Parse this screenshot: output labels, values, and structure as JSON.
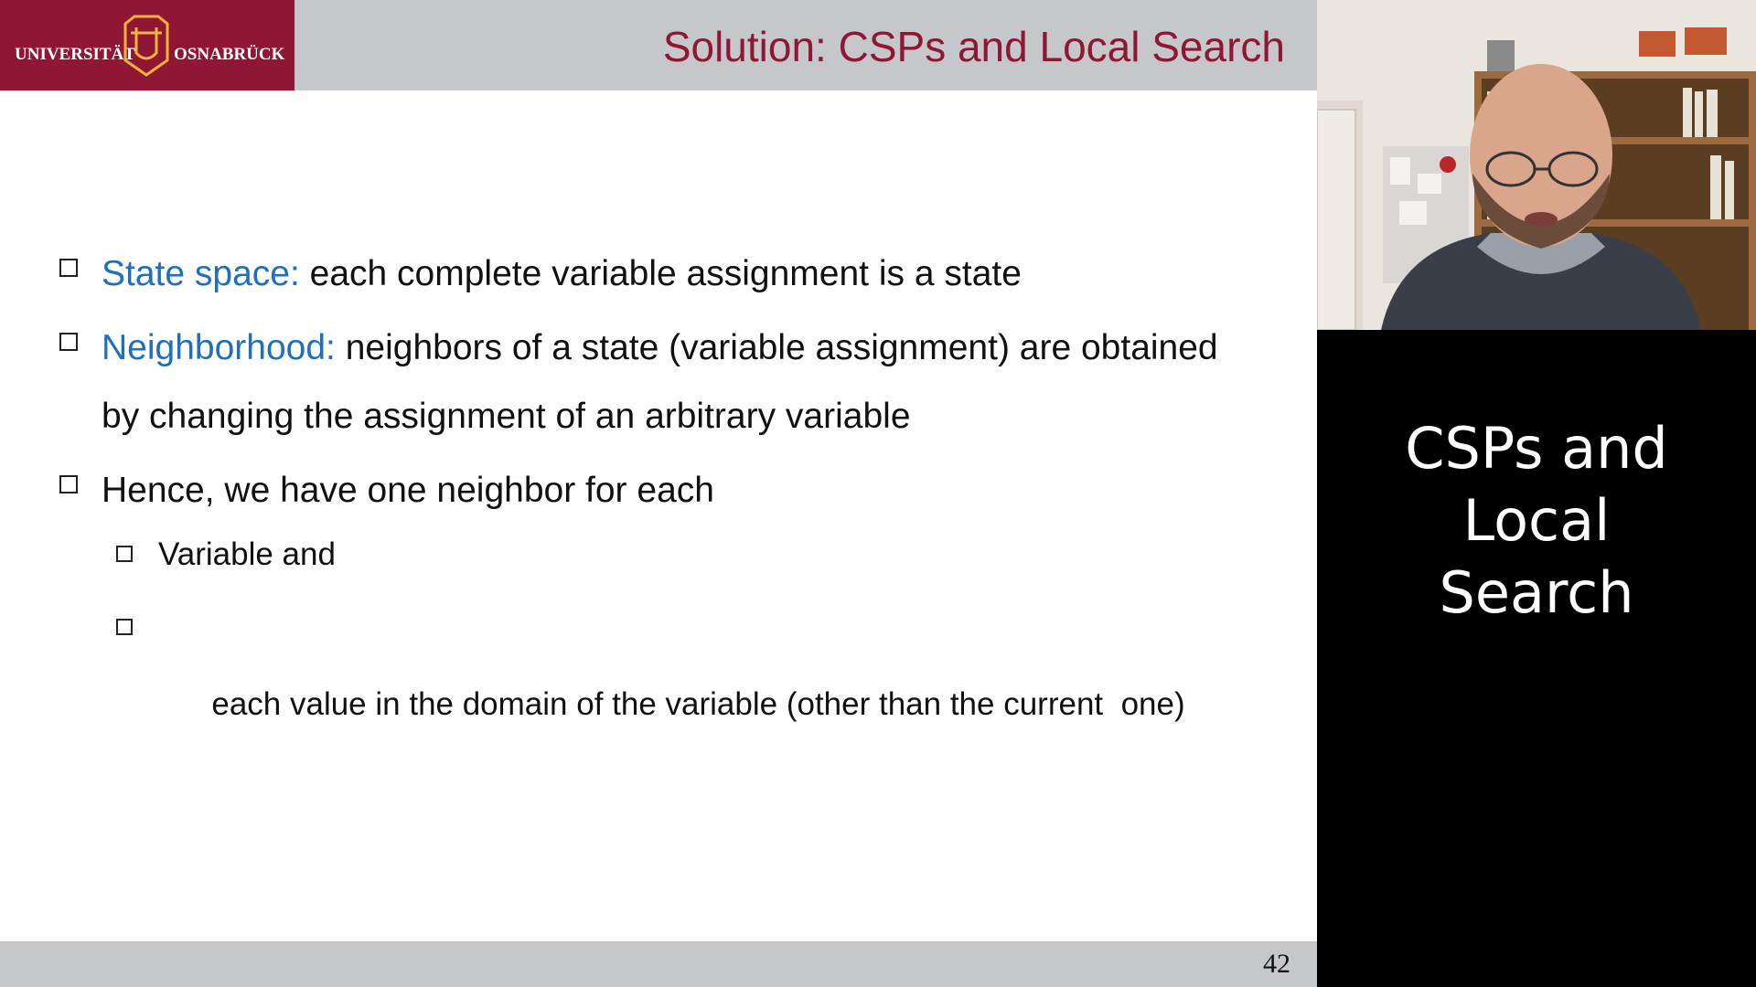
{
  "header": {
    "university_left": "UNIVERSITÄT",
    "university_right": "OSNABRÜCK",
    "title": "Solution: CSPs and Local Search"
  },
  "bullets": [
    {
      "term": "State space:",
      "text": "each complete variable assignment is a state"
    },
    {
      "term": "Neighborhood:",
      "text": "neighbors of a state (variable assignment) are obtained",
      "continuation": "by changing the assignment of an arbitrary variable"
    },
    {
      "text": "Hence, we have one neighbor for each",
      "sub": [
        "Variable and",
        "each value in the domain of the variable (other than the current  one)"
      ]
    }
  ],
  "footer": {
    "page_number": "42"
  },
  "side_panel": {
    "title_lines": [
      "CSPs and",
      "Local",
      "Search"
    ]
  },
  "colors": {
    "brand_red": "#8f1733",
    "accent_blue": "#1e6fbf",
    "bar_gray": "#c6c7cb"
  }
}
